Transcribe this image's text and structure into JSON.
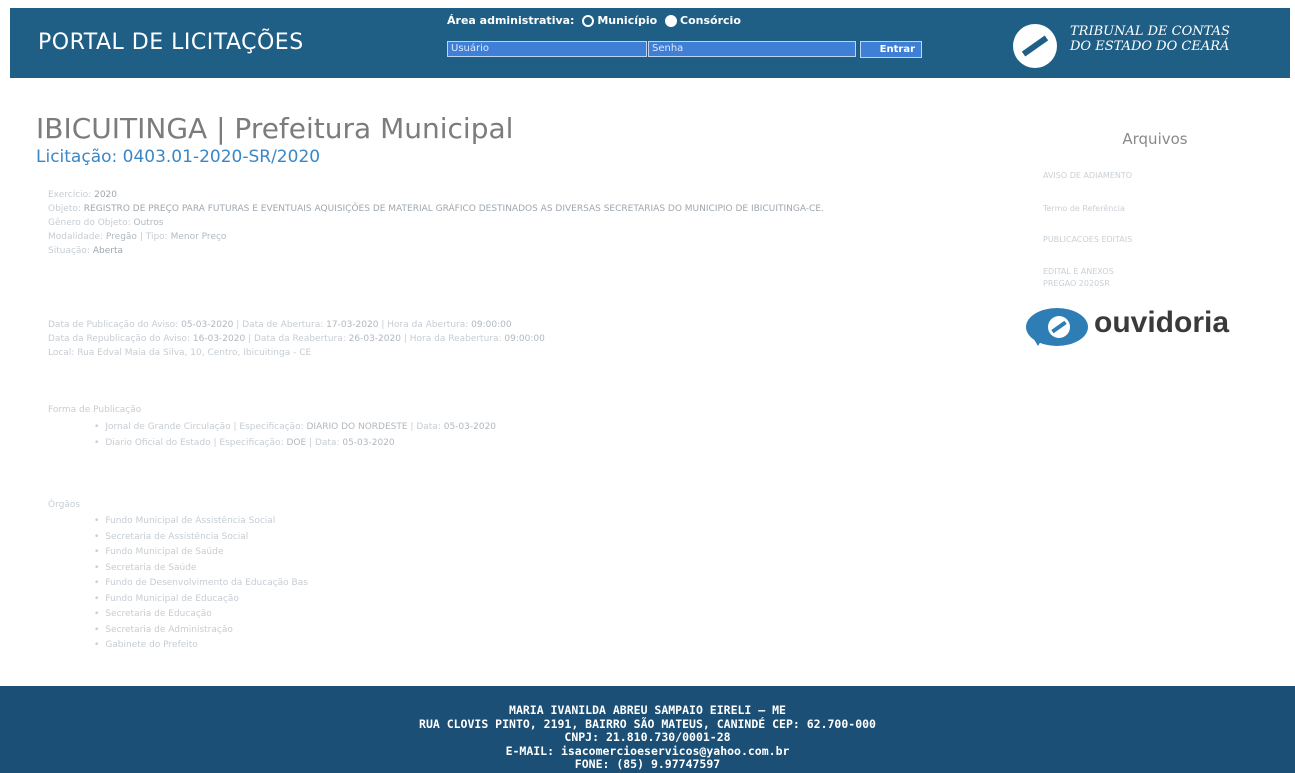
{
  "header": {
    "portal_title": "PORTAL DE LICITAÇÕES",
    "area_label": "Área administrativa:",
    "option_municipio": "Município",
    "option_consorcio": "Consórcio",
    "user_placeholder": "Usuário",
    "password_placeholder": "Senha",
    "login_label": "Entrar",
    "tce_line1": "TRIBUNAL DE CONTAS",
    "tce_line2": "DO ESTADO DO CEARÁ"
  },
  "main": {
    "title": "IBICUITINGA | Prefeitura Municipal",
    "bid_number": "Licitação: 0403.01-2020-SR/2020",
    "details": {
      "exercicio_label": "Exercício:",
      "exercicio_value": "2020",
      "objeto_label": "Objeto:",
      "objeto_value": "REGISTRO DE PREÇO PARA FUTURAS E EVENTUAIS AQUISIÇÕES DE MATERIAL GRÁFICO DESTINADOS AS DIVERSAS SECRETARIAS DO MUNICIPIO DE IBICUITINGA-CE.",
      "genero_label": "Gênero do Objeto:",
      "genero_value": "Outros",
      "modalidade_label": "Modalidade:",
      "modalidade_value": "Pregão",
      "tipo_label": "Tipo:",
      "tipo_value": "Menor Preço",
      "situacao_label": "Situação:",
      "situacao_value": "Aberta"
    },
    "dates": {
      "pub_label": "Data de Publicação do Aviso:",
      "pub_value": "05-03-2020",
      "abertura_label": "Data de Abertura:",
      "abertura_value": "17-03-2020",
      "hora_abertura_label": "Hora da Abertura:",
      "hora_abertura_value": "09:00:00",
      "repub_label": "Data da Republicação do Aviso:",
      "repub_value": "16-03-2020",
      "reabertura_label": "Data da Reabertura:",
      "reabertura_value": "26-03-2020",
      "hora_reabertura_label": "Hora da Reabertura:",
      "hora_reabertura_value": "09:00:00",
      "local_label": "Local:",
      "local_value": "Rua Edval Maia da Silva, 10, Centro, Ibicuitinga - CE"
    },
    "publication": {
      "heading": "Forma de Publicação",
      "items": [
        {
          "veiculo": "Jornal de Grande Circulação",
          "espec_label": "Especificação:",
          "espec": "DIARIO DO NORDESTE",
          "data_label": "Data:",
          "data": "05-03-2020"
        },
        {
          "veiculo": "Diario Oficial do Estado",
          "espec_label": "Especificação:",
          "espec": "DOE",
          "data_label": "Data:",
          "data": "05-03-2020"
        }
      ]
    },
    "orgaos": {
      "heading": "Órgãos",
      "items": [
        "Fundo Municipal de Assistência Social",
        "Secretaria de Assistência Social",
        "Fundo Municipal de Saúde",
        "Secretaria de Saúde",
        "Fundo de Desenvolvimento da Educação Bas",
        "Fundo Municipal de Educação",
        "Secretaria de Educação",
        "Secretaria de Administração",
        "Gabinete do Prefeito"
      ]
    }
  },
  "sidebar": {
    "title": "Arquivos",
    "files": [
      "AVISO DE ADIAMENTO",
      "Termo de Referência",
      "PUBLICACOES EDITAIS",
      "EDITAL E ANEXOS",
      "PREGAO 2020SR"
    ],
    "ouvidoria_text": "ouvidoria"
  },
  "footer": {
    "line1": "MARIA IVANILDA ABREU SAMPAIO EIRELI – ME",
    "line2": "RUA CLOVIS PINTO, 2191, BAIRRO SÃO MATEUS, CANINDÉ CEP: 62.700-000",
    "line3": "CNPJ: 21.810.730/0001-28",
    "line4": "E-MAIL: isacomercioeservicos@yahoo.com.br",
    "line5": "FONE: (85) 9.97747597"
  },
  "colors": {
    "header_bg": "#1f5f86",
    "footer_bg": "#1b4f75",
    "accent_blue": "#3a87c6"
  }
}
